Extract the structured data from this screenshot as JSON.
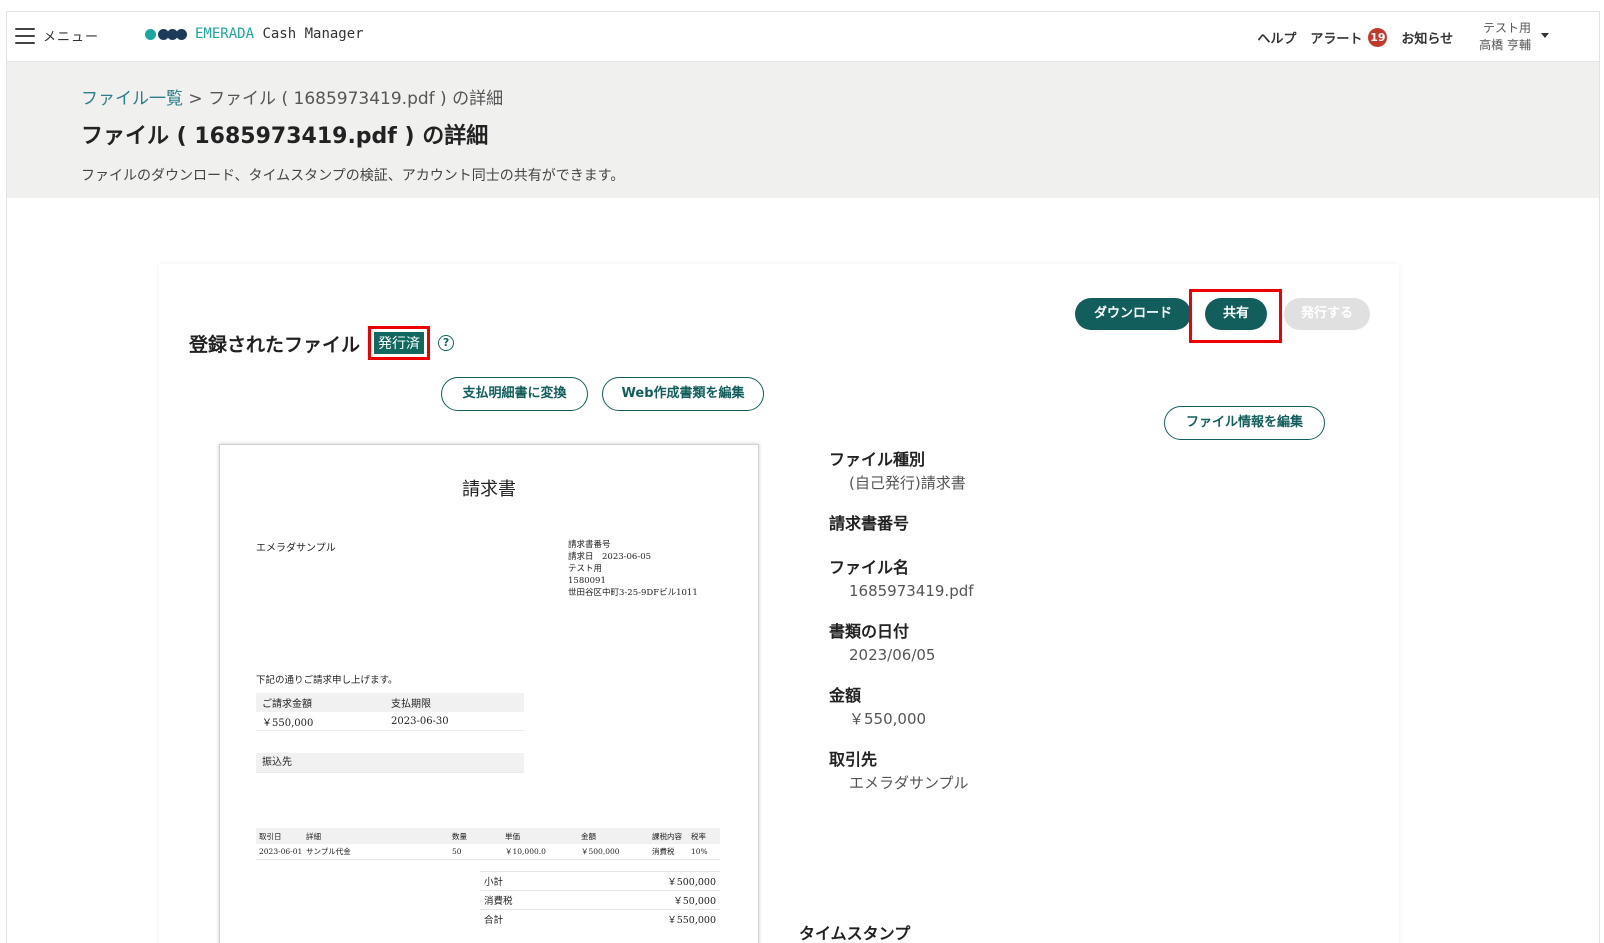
{
  "topbar": {
    "menu_label": "メニュー",
    "brand_accent": "EMERADA",
    "brand_rest": " Cash Manager",
    "help": "ヘルプ",
    "alert": "アラート",
    "alert_count": "19",
    "news": "お知らせ",
    "user_org": "テスト用",
    "user_name": "高橋 亨輔"
  },
  "header": {
    "breadcrumb_link": "ファイル一覧",
    "breadcrumb_sep": " > ",
    "breadcrumb_current": "ファイル ( 1685973419.pdf ) の詳細",
    "title": "ファイル ( 1685973419.pdf ) の詳細",
    "description": "ファイルのダウンロード、タイムスタンプの検証、アカウント同士の共有ができます。"
  },
  "card": {
    "section_title": "登録されたファイル",
    "status": "発行済",
    "help_icon": "?",
    "download": "ダウンロード",
    "share": "共有",
    "issue": "発行する",
    "convert": "支払明細書に変換",
    "edit_web_doc": "Web作成書類を編集",
    "edit_file_info": "ファイル情報を編集"
  },
  "document": {
    "title": "請求書",
    "sender": "エメラダサンプル",
    "meta": [
      "請求書番号",
      "請求日　2023-06-05",
      "テスト用",
      "1580091",
      "世田谷区中町3-25-9DFビル1011"
    ],
    "intro": "下記の通りご請求申し上げます。",
    "summary_headers": [
      "ご請求金額",
      "支払期限"
    ],
    "summary_values": [
      "￥550,000",
      "2023-06-30"
    ],
    "bank_label": "振込先",
    "items_headers": [
      "取引日",
      "詳細",
      "数量",
      "単価",
      "金額",
      "課税内容",
      "税率"
    ],
    "items_rows": [
      [
        "2023-06-01",
        "サンプル代金",
        "50",
        "￥10,000.0",
        "￥500,000",
        "消費税",
        "10%"
      ]
    ],
    "totals": [
      {
        "label": "小計",
        "value": "￥500,000"
      },
      {
        "label": "消費税",
        "value": "￥50,000"
      },
      {
        "label": "合計",
        "value": "￥550,000"
      }
    ]
  },
  "info": {
    "type_label": "ファイル種別",
    "type_value": "(自己発行)請求書",
    "number_label": "請求書番号",
    "number_value": "",
    "name_label": "ファイル名",
    "name_value": "1685973419.pdf",
    "date_label": "書類の日付",
    "date_value": "2023/06/05",
    "amount_label": "金額",
    "amount_value": "￥550,000",
    "partner_label": "取引先",
    "partner_value": "エメラダサンプル",
    "timestamp_label": "タイムスタンプ"
  },
  "colors": {
    "primary": "#125e5c",
    "accent": "#19a8a0",
    "highlight": "#ee0000",
    "badge": "#c0392b"
  }
}
